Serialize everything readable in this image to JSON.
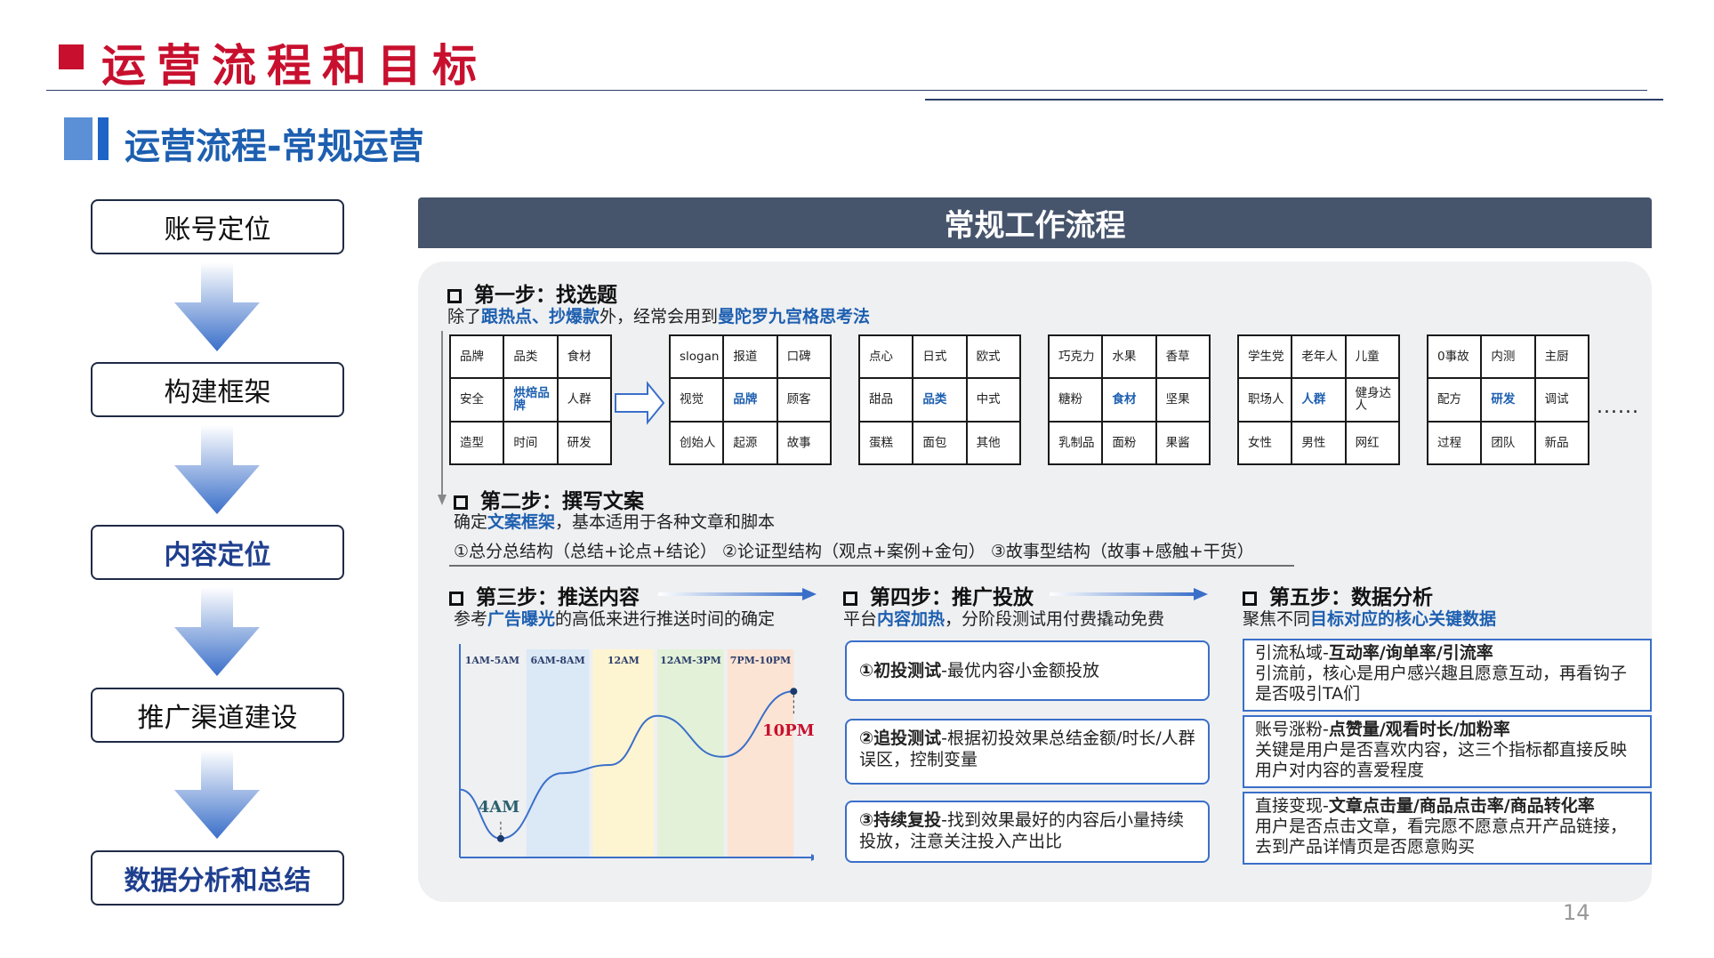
{
  "header": {
    "title": "运营流程和目标",
    "subtitle": "运营流程-常规运营"
  },
  "left_flow": [
    {
      "label": "账号定位"
    },
    {
      "label": "构建框架"
    },
    {
      "label": "内容定位"
    },
    {
      "label": "推广渠道建设"
    },
    {
      "label": "数据分析和总结"
    }
  ],
  "main": {
    "panel_title": "常规工作流程",
    "step1": {
      "title": "第一步：找选题",
      "desc": {
        "p1": "除了",
        "h1": "跟热点、抄爆款",
        "p2": "外，经常会用到",
        "h2": "曼陀罗九宫格思考法"
      },
      "grids": [
        [
          "品牌",
          "品类",
          "食材",
          "安全",
          "烘焙品牌",
          "人群",
          "造型",
          "时间",
          "研发"
        ],
        [
          "slogan",
          "报道",
          "口碑",
          "视觉",
          "品牌",
          "顾客",
          "创始人",
          "起源",
          "故事"
        ],
        [
          "点心",
          "日式",
          "欧式",
          "甜品",
          "品类",
          "中式",
          "蛋糕",
          "面包",
          "其他"
        ],
        [
          "巧克力",
          "水果",
          "香草",
          "糖粉",
          "食材",
          "坚果",
          "乳制品",
          "面粉",
          "果酱"
        ],
        [
          "学生党",
          "老年人",
          "儿童",
          "职场人",
          "人群",
          "健身达人",
          "女性",
          "男性",
          "网红"
        ],
        [
          "0事故",
          "内测",
          "主厨",
          "配方",
          "研发",
          "调试",
          "过程",
          "团队",
          "新品"
        ]
      ],
      "more": "......"
    },
    "step2": {
      "title": "第二步：撰写文案",
      "desc": {
        "p1": "确定",
        "h1": "文案框架",
        "p2": "，基本适用于各种文章和脚本"
      },
      "structures": "①总分总结构（总结+论点+结论） ②论证型结构（观点+案例+金句） ③故事型结构（故事+感触+干货）"
    },
    "step3": {
      "title": "第三步：推送内容",
      "desc": {
        "p1": "参考",
        "h1": "广告曝光",
        "p2": "的高低来进行推送时间的确定"
      }
    },
    "step4": {
      "title": "第四步：推广投放",
      "desc": {
        "p1": "平台",
        "h1": "内容加热",
        "p2": "，分阶段测试用付费撬动免费"
      },
      "items": [
        {
          "head": "①初投测试",
          "text": "-最优内容小金额投放"
        },
        {
          "head": "②追投测试",
          "text": "-根据初投效果总结金额/时长/人群误区，控制变量"
        },
        {
          "head": "③持续复投",
          "text": "-找到效果最好的内容后小量持续投放，注意关注投入产出比"
        }
      ]
    },
    "step5": {
      "title": "第五步：数据分析",
      "desc": {
        "p1": "聚焦不同",
        "h1": "目标对应的核心关键数据"
      },
      "items": [
        {
          "head": "引流私域-",
          "metric": "互动率/询单率/引流率",
          "text": "引流前，核心是用户感兴趣且愿意互动，再看钩子是否吸引TA们"
        },
        {
          "head": "账号涨粉-",
          "metric": "点赞量/观看时长/加粉率",
          "text": "关键是用户是否喜欢内容，这三个指标都直接反映用户对内容的喜爱程度"
        },
        {
          "head": "直接变现-",
          "metric": "文章点击量/商品点击率/商品转化率",
          "text": "用户是否点击文章，看完愿不愿意点开产品链接，去到产品详情页是否愿意购买"
        }
      ]
    }
  },
  "chart_data": {
    "type": "line",
    "bands": [
      "1AM-5AM",
      "6AM-8AM",
      "12AM",
      "12AM-3PM",
      "7PM-10PM"
    ],
    "band_colors": [
      "#eef0f2",
      "#dbe8f6",
      "#fdf4d2",
      "#e2f1d8",
      "#fbe4d4"
    ],
    "x": [
      "1AM",
      "4AM",
      "8AM",
      "12AM",
      "3PM",
      "7PM",
      "10PM"
    ],
    "y": [
      0.35,
      0.05,
      0.45,
      0.5,
      0.8,
      0.55,
      0.95
    ],
    "annotations": [
      "4AM",
      "10PM"
    ]
  },
  "page_number": "14",
  "colors": {
    "title_red": "#c8102e",
    "accent_blue": "#1d5fb0",
    "header_gray": "#46546c",
    "panel_bg": "#eff0f2",
    "box_border": "#3a6fc9"
  }
}
